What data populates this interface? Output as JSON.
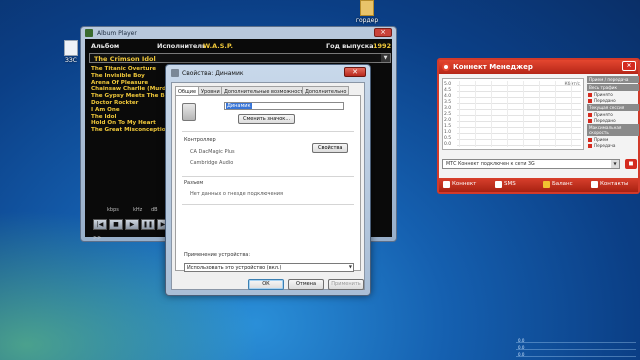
{
  "desktop": {
    "icons": [
      {
        "name": "folder-shortcut",
        "label": "гордер"
      },
      {
        "name": "document-file",
        "label": "ЗЗС"
      }
    ]
  },
  "album_player": {
    "title": "Album Player",
    "album_label": "Альбом",
    "artist_label": "Исполнитель",
    "artist_value": "W.A.S.P.",
    "year_label": "Год выпуска",
    "year_value": "1992",
    "album_selected": "The Crimson Idol",
    "tracks": [
      "The Titanic Overture",
      "The Invisible Boy",
      "Arena Of Pleasure",
      "Chainsaw Charlie (Murders In The New Morgue)",
      "The Gypsy Meets The Boy",
      "Doctor Rockter",
      "I Am One",
      "The Idol",
      "Hold On To My Heart",
      "The Great Misconceptions Of Me"
    ],
    "stats": [
      "kbps",
      "kHz",
      "dB"
    ],
    "controls": [
      "|◀",
      "■",
      "▶",
      "❚❚",
      "▶|"
    ],
    "footer": ">>"
  },
  "konnekt": {
    "title": "Коннект Менеджер",
    "kbps": "Кбит/с",
    "y_labels": [
      "5.0",
      "4.5",
      "4.0",
      "3.5",
      "3.0",
      "2.5",
      "2.0",
      "1.5",
      "1.0",
      "0.5",
      "0.0"
    ],
    "side_sections": [
      {
        "header": "Прием / передача",
        "rows": []
      },
      {
        "header": "Весь трафик",
        "rows": [
          "Принято",
          "Передано"
        ]
      },
      {
        "header": "Текущая сессия",
        "rows": [
          "Принято",
          "Передано"
        ]
      },
      {
        "header": "Максимальная скорость",
        "rows": [
          "Прием",
          "Передача"
        ]
      }
    ],
    "status": "МТС Коннект подключен к сети 3G",
    "stop_glyph": "◼",
    "tabs": [
      "Коннект",
      "SMS",
      "Баланс",
      "Контакты"
    ],
    "accent": "#d42b1f"
  },
  "properties": {
    "title": "Свойства: Динамик",
    "close_glyph": "✕",
    "tabs": [
      "Общие",
      "Уровни",
      "Дополнительные возможности",
      "Дополнительно"
    ],
    "device_name": "Динамик",
    "change_icon_label": "Сменить значок...",
    "controller_label": "Контроллер",
    "controller_name": "CA DacMagic Plus",
    "controller_vendor": "Cambridge Audio",
    "properties_button": "Свойства",
    "jack_label": "Разъем",
    "jack_info": "Нет данных о гнезде подключения",
    "usage_label": "Применение устройства:",
    "usage_value": "Использовать это устройство (вкл.)",
    "ok": "ОК",
    "cancel": "Отмена",
    "apply": "Применить"
  },
  "status_meter": {
    "labels": [
      "0.0",
      "0.0",
      "0.0"
    ]
  }
}
